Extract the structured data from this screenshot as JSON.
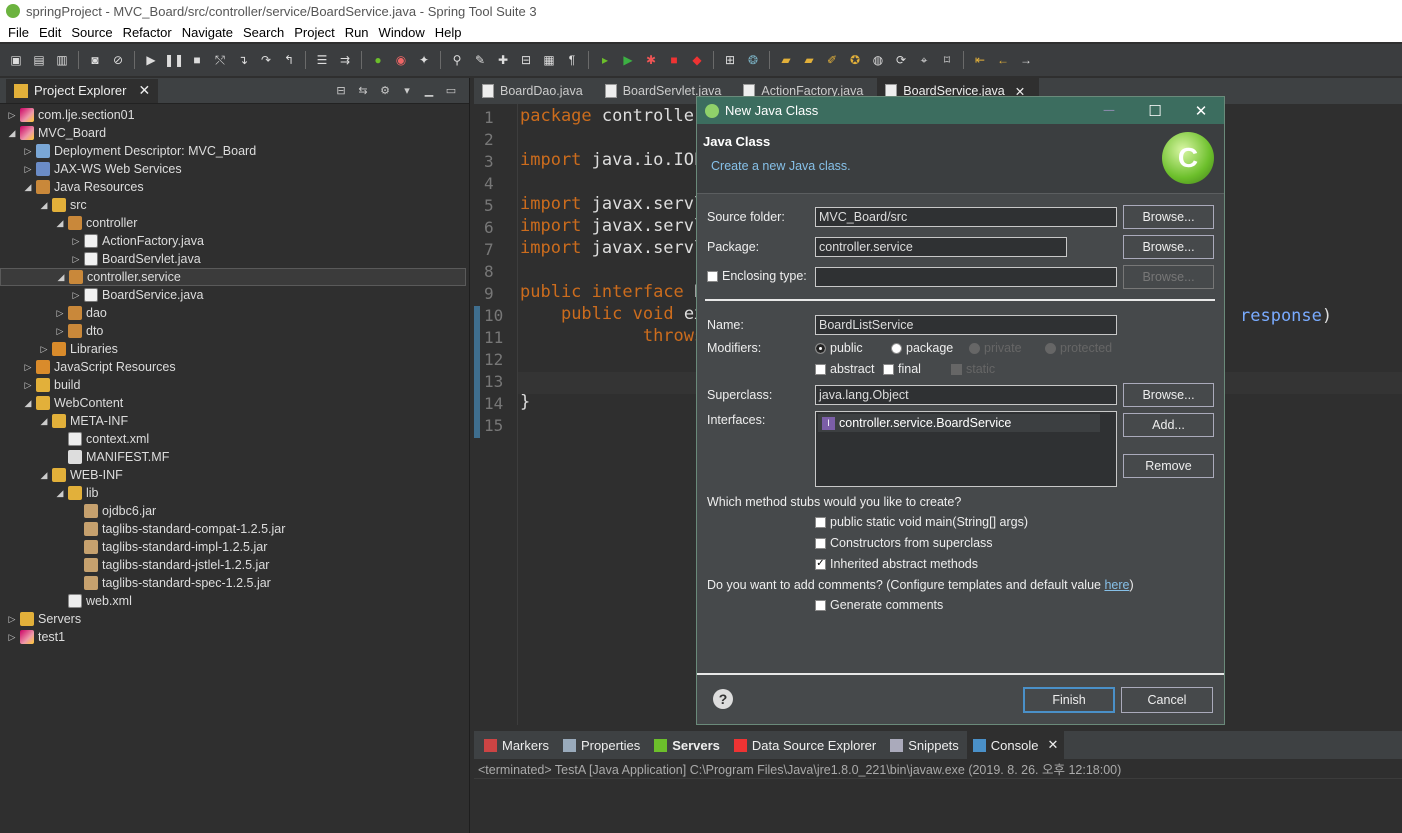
{
  "window": {
    "title": "springProject - MVC_Board/src/controller/service/BoardService.java - Spring Tool Suite 3"
  },
  "menubar": [
    "File",
    "Edit",
    "Source",
    "Refactor",
    "Navigate",
    "Search",
    "Project",
    "Run",
    "Window",
    "Help"
  ],
  "explorer": {
    "tab_label": "Project Explorer",
    "tree": [
      {
        "label": "com.lje.section01",
        "depth": 0,
        "arrow": "▷",
        "icon": "project-icon"
      },
      {
        "label": "MVC_Board",
        "depth": 0,
        "arrow": "◢",
        "icon": "project-icon"
      },
      {
        "label": "Deployment Descriptor: MVC_Board",
        "depth": 1,
        "arrow": "▷",
        "icon": "descriptor-icon"
      },
      {
        "label": "JAX-WS Web Services",
        "depth": 1,
        "arrow": "▷",
        "icon": "web-services-icon"
      },
      {
        "label": "Java Resources",
        "depth": 1,
        "arrow": "◢",
        "icon": "java-resources-icon"
      },
      {
        "label": "src",
        "depth": 2,
        "arrow": "◢",
        "icon": "source-folder-icon"
      },
      {
        "label": "controller",
        "depth": 3,
        "arrow": "◢",
        "icon": "package-icon"
      },
      {
        "label": "ActionFactory.java",
        "depth": 4,
        "arrow": "▷",
        "icon": "java-file-icon"
      },
      {
        "label": "BoardServlet.java",
        "depth": 4,
        "arrow": "▷",
        "icon": "java-file-icon"
      },
      {
        "label": "controller.service",
        "depth": 3,
        "arrow": "◢",
        "icon": "package-icon",
        "selected": true
      },
      {
        "label": "BoardService.java",
        "depth": 4,
        "arrow": "▷",
        "icon": "java-interface-icon"
      },
      {
        "label": "dao",
        "depth": 3,
        "arrow": "▷",
        "icon": "package-icon"
      },
      {
        "label": "dto",
        "depth": 3,
        "arrow": "▷",
        "icon": "package-icon"
      },
      {
        "label": "Libraries",
        "depth": 2,
        "arrow": "▷",
        "icon": "library-icon"
      },
      {
        "label": "JavaScript Resources",
        "depth": 1,
        "arrow": "▷",
        "icon": "js-resources-icon"
      },
      {
        "label": "build",
        "depth": 1,
        "arrow": "▷",
        "icon": "folder-icon"
      },
      {
        "label": "WebContent",
        "depth": 1,
        "arrow": "◢",
        "icon": "folder-icon"
      },
      {
        "label": "META-INF",
        "depth": 2,
        "arrow": "◢",
        "icon": "folder-icon"
      },
      {
        "label": "context.xml",
        "depth": 3,
        "arrow": "",
        "icon": "xml-file-icon"
      },
      {
        "label": "MANIFEST.MF",
        "depth": 3,
        "arrow": "",
        "icon": "text-file-icon"
      },
      {
        "label": "WEB-INF",
        "depth": 2,
        "arrow": "◢",
        "icon": "folder-icon"
      },
      {
        "label": "lib",
        "depth": 3,
        "arrow": "◢",
        "icon": "folder-icon"
      },
      {
        "label": "ojdbc6.jar",
        "depth": 4,
        "arrow": "",
        "icon": "jar-icon"
      },
      {
        "label": "taglibs-standard-compat-1.2.5.jar",
        "depth": 4,
        "arrow": "",
        "icon": "jar-icon"
      },
      {
        "label": "taglibs-standard-impl-1.2.5.jar",
        "depth": 4,
        "arrow": "",
        "icon": "jar-icon"
      },
      {
        "label": "taglibs-standard-jstlel-1.2.5.jar",
        "depth": 4,
        "arrow": "",
        "icon": "jar-icon"
      },
      {
        "label": "taglibs-standard-spec-1.2.5.jar",
        "depth": 4,
        "arrow": "",
        "icon": "jar-icon"
      },
      {
        "label": "web.xml",
        "depth": 3,
        "arrow": "",
        "icon": "xml-file-icon"
      },
      {
        "label": "Servers",
        "depth": 0,
        "arrow": "▷",
        "icon": "folder-icon"
      },
      {
        "label": "test1",
        "depth": 0,
        "arrow": "▷",
        "icon": "project-icon"
      }
    ]
  },
  "editor": {
    "tabs": [
      {
        "label": "BoardDao.java",
        "active": false
      },
      {
        "label": "BoardServlet.java",
        "active": false
      },
      {
        "label": "ActionFactory.java",
        "active": false
      },
      {
        "label": "BoardService.java",
        "active": true
      }
    ],
    "line_numbers": [
      "1",
      "2",
      "3",
      "4",
      "5",
      "6",
      "7",
      "8",
      "9",
      "10",
      "11",
      "12",
      "13",
      "14",
      "15"
    ],
    "lines": [
      [
        {
          "k": "kw",
          "t": "package"
        },
        {
          "k": "",
          "t": " controller"
        }
      ],
      [],
      [
        {
          "k": "kw",
          "t": "import"
        },
        {
          "k": "",
          "t": " java.io.IOE"
        }
      ],
      [],
      [
        {
          "k": "kw",
          "t": "import"
        },
        {
          "k": "",
          "t": " javax.servl"
        }
      ],
      [
        {
          "k": "kw",
          "t": "import"
        },
        {
          "k": "",
          "t": " javax.servl"
        }
      ],
      [
        {
          "k": "kw",
          "t": "import"
        },
        {
          "k": "",
          "t": " javax.servl"
        }
      ],
      [],
      [
        {
          "k": "kw",
          "t": "public"
        },
        {
          "k": "",
          "t": " "
        },
        {
          "k": "kw",
          "t": "interface"
        },
        {
          "k": "",
          "t": " B"
        }
      ],
      [
        {
          "k": "",
          "t": "    "
        },
        {
          "k": "kw",
          "t": "public"
        },
        {
          "k": "",
          "t": " "
        },
        {
          "k": "kw",
          "t": "void"
        },
        {
          "k": "",
          "t": " ex"
        }
      ],
      [
        {
          "k": "",
          "t": "            "
        },
        {
          "k": "kw",
          "t": "throws"
        }
      ],
      [],
      [],
      [
        {
          "k": "",
          "t": "}"
        }
      ],
      []
    ],
    "overflow_text": {
      "param": "response",
      "tail": ")"
    }
  },
  "bottom": {
    "tabs": [
      "Markers",
      "Properties",
      "Servers",
      "Data Source Explorer",
      "Snippets",
      "Console"
    ],
    "active_tab": "Console",
    "console_status": "<terminated> TestA [Java Application] C:\\Program Files\\Java\\jre1.8.0_221\\bin\\javaw.exe (2019. 8. 26. 오후 12:18:00)"
  },
  "dialog": {
    "title": "New Java Class",
    "heading": "Java Class",
    "subheading": "Create a new Java class.",
    "banner_letter": "C",
    "source_folder": {
      "label": "Source folder:",
      "value": "MVC_Board/src",
      "button": "Browse..."
    },
    "package": {
      "label": "Package:",
      "value": "controller.service",
      "button": "Browse..."
    },
    "enclosing": {
      "label": "Enclosing type:",
      "value": "",
      "button": "Browse..."
    },
    "name": {
      "label": "Name:",
      "value": "BoardListService"
    },
    "modifiers": {
      "label": "Modifiers:",
      "options": [
        "public",
        "package",
        "private",
        "protected"
      ],
      "selected": "public",
      "checks": [
        "abstract",
        "final",
        "static"
      ]
    },
    "superclass": {
      "label": "Superclass:",
      "value": "java.lang.Object",
      "button": "Browse..."
    },
    "interfaces": {
      "label": "Interfaces:",
      "items": [
        "controller.service.BoardService"
      ],
      "add_button": "Add...",
      "remove_button": "Remove"
    },
    "stubs": {
      "question": "Which method stubs would you like to create?",
      "options": [
        {
          "label": "public static void main(String[] args)",
          "checked": false
        },
        {
          "label": "Constructors from superclass",
          "checked": false
        },
        {
          "label": "Inherited abstract methods",
          "checked": true
        }
      ]
    },
    "comments": {
      "question_before": "Do you want to add comments? (Configure templates and default value ",
      "link": "here",
      "question_after": ")",
      "option": "Generate comments",
      "checked": false
    },
    "finish_button": "Finish",
    "cancel_button": "Cancel"
  }
}
